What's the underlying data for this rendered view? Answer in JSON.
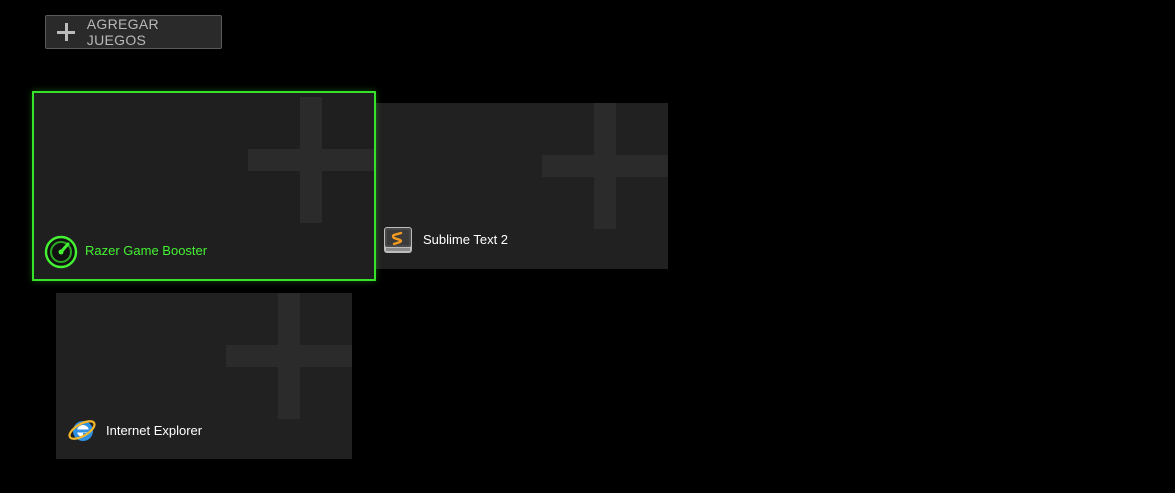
{
  "toolbar": {
    "add_games_label": "AGREGAR JUEGOS",
    "add_icon": "plus-icon"
  },
  "games": [
    {
      "label": "Razer Game Booster",
      "icon": "razer-game-booster-icon",
      "selected": true
    },
    {
      "label": "Sublime Text 2",
      "icon": "sublime-text-icon",
      "selected": false
    },
    {
      "label": "Internet Explorer",
      "icon": "internet-explorer-icon",
      "selected": false
    }
  ],
  "colors": {
    "background": "#000000",
    "tile": "#222222",
    "selected_border": "#37e22b",
    "selected_text": "#44f233",
    "button_bg": "#2a2a2a",
    "button_text": "#b8b8b8"
  }
}
